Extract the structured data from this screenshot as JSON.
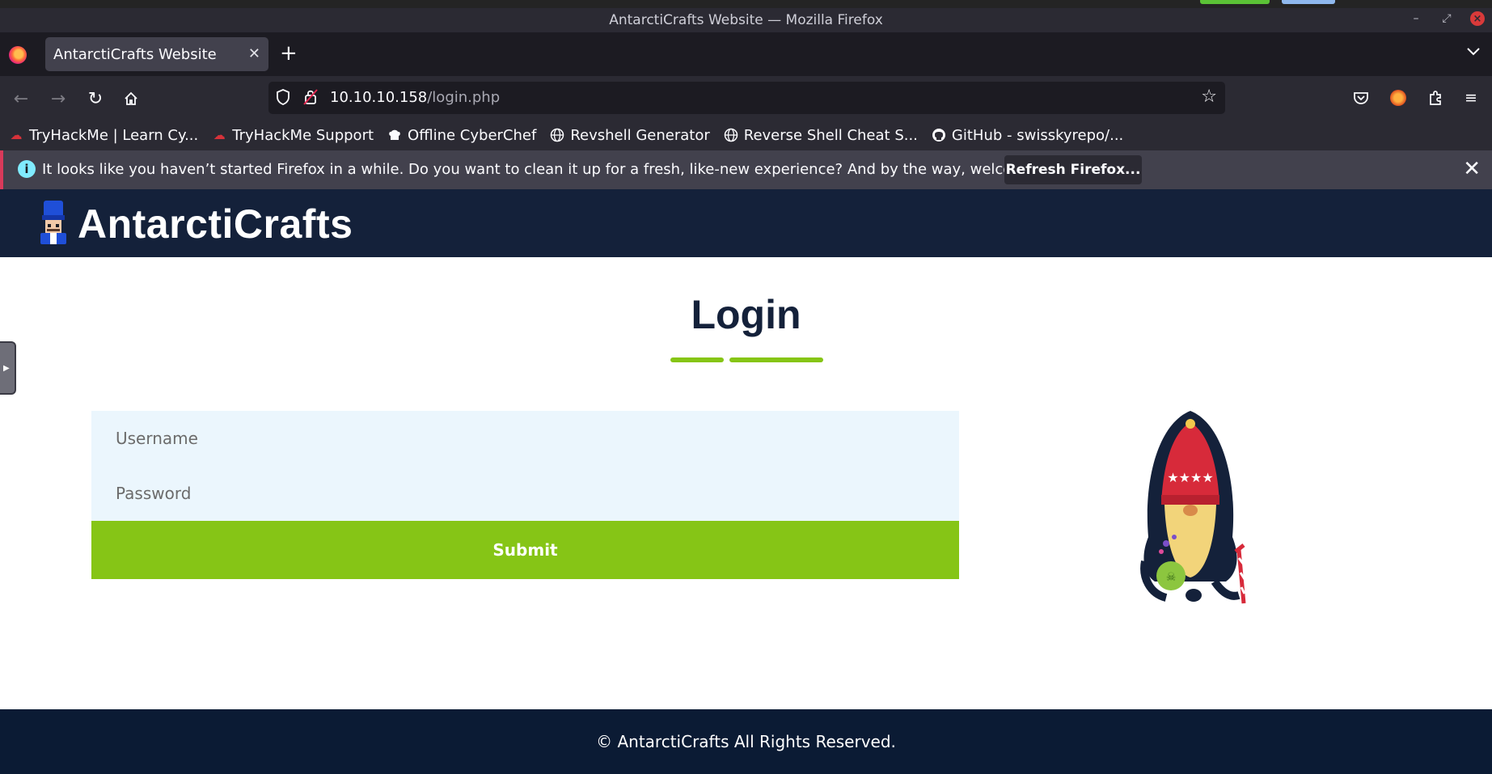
{
  "window": {
    "title": "AntarctiCrafts Website — Mozilla Firefox"
  },
  "tabs": [
    {
      "label": "AntarctiCrafts Website"
    }
  ],
  "urlbar": {
    "host": "10.10.10.158",
    "path": "/login.php"
  },
  "bookmarks": [
    {
      "label": "TryHackMe | Learn Cy...",
      "icon": "tryhackme-icon"
    },
    {
      "label": "TryHackMe Support",
      "icon": "tryhackme-icon"
    },
    {
      "label": "Offline CyberChef",
      "icon": "chef-hat-icon"
    },
    {
      "label": "Revshell Generator",
      "icon": "globe-icon"
    },
    {
      "label": "Reverse Shell Cheat S...",
      "icon": "globe-icon"
    },
    {
      "label": "GitHub - swisskyrepo/...",
      "icon": "github-icon"
    }
  ],
  "notification": {
    "text": "It looks like you haven’t started Firefox in a while. Do you want to clean it up for a fresh, like-new experience? And by the way, welcome back!",
    "button": "Refresh Firefox..."
  },
  "site": {
    "brand": "AntarctiCrafts",
    "page_title": "Login",
    "form": {
      "username_placeholder": "Username",
      "password_placeholder": "Password",
      "submit_label": "Submit"
    },
    "footer": "© AntarctiCrafts All Rights Reserved."
  },
  "colors": {
    "header_bg": "#14213a",
    "accent_green": "#86c516",
    "field_bg": "#ebf6fd",
    "footer_bg": "#0b1b34"
  }
}
